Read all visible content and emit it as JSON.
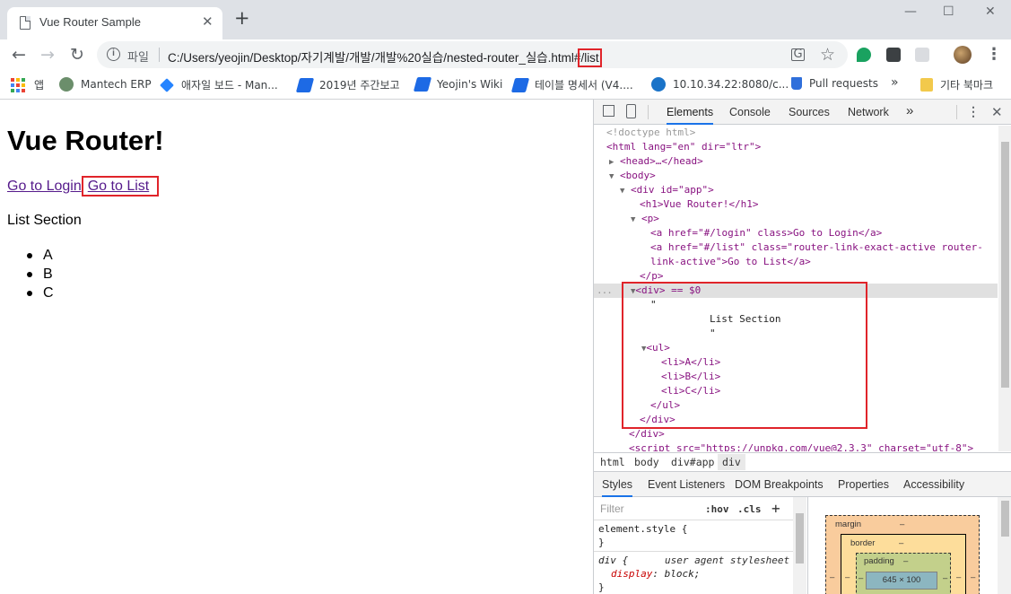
{
  "browser": {
    "tab_title": "Vue Router Sample",
    "tab_close": "✕",
    "new_tab": "+",
    "window_minimize": "—",
    "window_maximize": "☐",
    "window_close": "✕",
    "nav_back": "←",
    "nav_forward": "→",
    "nav_reload": "↻",
    "scheme_label": "파일",
    "url_main": "C:/Users/yeojin/Desktop/자기계발/개발/개발%20실습/nested-router_실습.html#",
    "url_hash": "/list",
    "star": "☆",
    "menu": "⋮"
  },
  "bookmarks": [
    {
      "label": "앱",
      "icon": "apps-grid-icon"
    },
    {
      "label": "Mantech ERP",
      "icon": "mantech-icon",
      "color": "#6b8e6b"
    },
    {
      "label": "애자일 보드 - Man...",
      "icon": "jira-icon",
      "color": "#2684ff"
    },
    {
      "label": "2019년 주간보고",
      "icon": "confluence-icon",
      "color": "#1d6ae5"
    },
    {
      "label": "Yeojin's Wiki",
      "icon": "confluence-icon",
      "color": "#1d6ae5"
    },
    {
      "label": "테이블 명세서 (V4....",
      "icon": "confluence-icon",
      "color": "#1d6ae5"
    },
    {
      "label": "10.10.34.22:8080/c...",
      "icon": "swirl-icon",
      "color": "#1a73c8"
    },
    {
      "label": "Pull requests",
      "icon": "pull-request-icon",
      "color": "#2f6fdb"
    },
    {
      "label": "»",
      "icon": "overflow-icon"
    },
    {
      "label": "기타 북마크",
      "icon": "folder-icon",
      "color": "#f2c94c"
    }
  ],
  "page": {
    "heading": "Vue Router!",
    "link_login": "Go to Login",
    "link_list": "Go to List",
    "section_title": "List Section",
    "list_items": [
      "A",
      "B",
      "C"
    ]
  },
  "devtools": {
    "tabs": [
      "Elements",
      "Console",
      "Sources",
      "Network"
    ],
    "more_tabs": "»",
    "dom_lines": [
      "<!doctype html>",
      "<html lang=\"en\" dir=\"ltr\">",
      "<head>…</head>",
      "<body>",
      "<div id=\"app\">",
      "<h1>Vue Router!</h1>",
      "<p>",
      "<a href=\"#/login\" class>Go to Login</a>",
      "<a href=\"#/list\" class=\"router-link-exact-active router-",
      "link-active\">Go to List</a>",
      "</p>",
      "<div> == $0",
      "\"",
      "List Section",
      "\"",
      "<ul>",
      "<li>A</li>",
      "<li>B</li>",
      "<li>C</li>",
      "</ul>",
      "</div>",
      "</div>",
      "<script src=\"https://unpkg.com/vue@2.3.3\" charset=\"utf-8\">"
    ],
    "row_ellipsis": "...",
    "breadcrumbs": [
      "html",
      "body",
      "div#app",
      "div"
    ],
    "subtabs": [
      "Styles",
      "Event Listeners",
      "DOM Breakpoints",
      "Properties",
      "Accessibility"
    ],
    "filter_placeholder": "Filter",
    "hov": ":hov",
    "cls": ".cls",
    "add_rule": "+",
    "styles": {
      "element_style_selector": "element.style {",
      "close_brace": "}",
      "rule_selector": "div {",
      "rule_source": "user agent stylesheet",
      "prop_name": "display",
      "prop_value": "block;"
    },
    "box_model": {
      "margin_label": "margin",
      "margin_value": "–",
      "border_label": "border",
      "border_value": "–",
      "padding_label": "padding",
      "padding_value": "–",
      "content_size": "645 × 100",
      "side_dash": "–"
    }
  },
  "colors": {
    "highlight": "#e0242a",
    "visited_link": "#551a8b",
    "devtools_active": "#1a73e8"
  }
}
